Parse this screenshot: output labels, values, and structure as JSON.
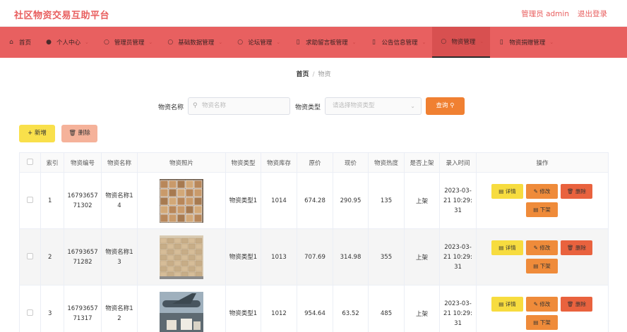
{
  "header": {
    "title": "社区物资交易互助平台",
    "admin": "管理员 admin",
    "logout": "退出登录"
  },
  "nav": [
    {
      "label": "首页",
      "icon": "home-icon",
      "glyph": "⌂",
      "chev": false
    },
    {
      "label": "个人中心",
      "icon": "user-icon",
      "glyph": "●",
      "chev": true
    },
    {
      "label": "管理员管理",
      "icon": "admin-icon",
      "glyph": "○",
      "chev": true
    },
    {
      "label": "基础数据管理",
      "icon": "data-icon",
      "glyph": "○",
      "chev": true
    },
    {
      "label": "论坛管理",
      "icon": "forum-icon",
      "glyph": "○",
      "chev": true
    },
    {
      "label": "求助留言板管理",
      "icon": "message-icon",
      "glyph": "▯",
      "chev": true
    },
    {
      "label": "公告信息管理",
      "icon": "notice-icon",
      "glyph": "▯",
      "chev": true
    },
    {
      "label": "物资管理",
      "icon": "goods-icon",
      "glyph": "○",
      "chev": true
    },
    {
      "label": "物资捐赠管理",
      "icon": "donate-icon",
      "glyph": "▯",
      "chev": true
    }
  ],
  "breadcrumb": {
    "home": "首页",
    "sep": "/",
    "current": "物资"
  },
  "search": {
    "name_label": "物资名称",
    "name_placeholder": "物资名称",
    "type_label": "物资类型",
    "type_placeholder": "请选择物资类型",
    "query_label": "查询"
  },
  "actions": {
    "add_label": "+ 新增",
    "delete_label": "删除"
  },
  "table": {
    "columns": [
      "",
      "索引",
      "物资编号",
      "物资名称",
      "物资照片",
      "物资类型",
      "物资库存",
      "原价",
      "现价",
      "物资热度",
      "是否上架",
      "录入时间",
      "操作"
    ],
    "rows": [
      {
        "index": "1",
        "code": "1679365771302",
        "name": "物资名称14",
        "type": "物资类型1",
        "stock": "1014",
        "orig": "674.28",
        "price": "290.95",
        "heat": "135",
        "status": "上架",
        "time": "2023-03-21 10:29:31",
        "photo": "boxes"
      },
      {
        "index": "2",
        "code": "1679365771282",
        "name": "物资名称13",
        "type": "物资类型1",
        "stock": "1013",
        "orig": "707.69",
        "price": "314.98",
        "heat": "355",
        "status": "上架",
        "time": "2023-03-21 10:29:31",
        "photo": "warehouse"
      },
      {
        "index": "3",
        "code": "1679365771317",
        "name": "物资名称12",
        "type": "物资类型1",
        "stock": "1012",
        "orig": "954.64",
        "price": "63.52",
        "heat": "485",
        "status": "上架",
        "time": "2023-03-21 10:29:31",
        "photo": "airplane"
      }
    ],
    "ops": {
      "detail": "详情",
      "edit": "修改",
      "remove": "删除",
      "down": "下架"
    }
  },
  "colors": {
    "brand": "#e85e5e",
    "nav": "#e86060",
    "query": "#f08032",
    "add": "#f9e04b"
  }
}
